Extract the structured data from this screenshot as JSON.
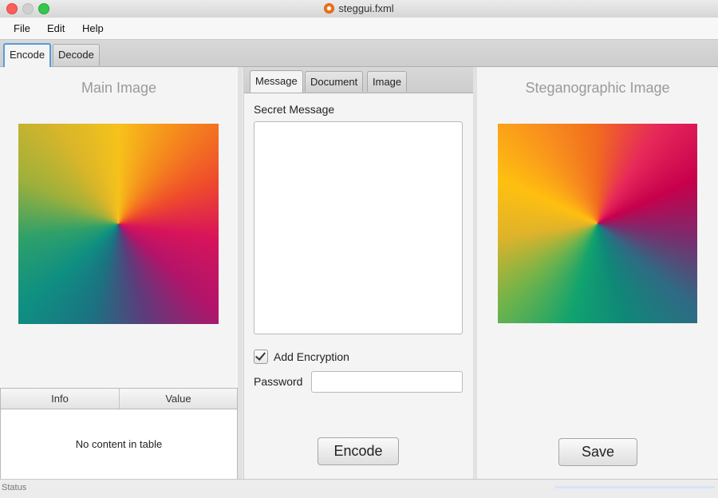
{
  "window": {
    "title": "steggui.fxml"
  },
  "menu": [
    "File",
    "Edit",
    "Help"
  ],
  "top_tabs": [
    {
      "label": "Encode",
      "active": true
    },
    {
      "label": "Decode",
      "active": false
    }
  ],
  "left_panel": {
    "title": "Main Image",
    "table": {
      "columns": [
        "Info",
        "Value"
      ],
      "empty_message": "No content in table"
    }
  },
  "middle_panel": {
    "tabs": [
      {
        "label": "Message",
        "active": true
      },
      {
        "label": "Document",
        "active": false
      },
      {
        "label": "Image",
        "active": false
      }
    ],
    "secret_message_label": "Secret Message",
    "secret_message_value": "",
    "encryption_label": "Add Encryption",
    "encryption_checked": true,
    "password_label": "Password",
    "password_value": "",
    "encode_button": "Encode"
  },
  "right_panel": {
    "title": "Steganographic Image",
    "save_button": "Save"
  },
  "status": {
    "text": "Status",
    "progress": 0
  },
  "colors": {
    "active_tab_border": "#5a9bd8",
    "progress_track": "#d6e4f5"
  }
}
